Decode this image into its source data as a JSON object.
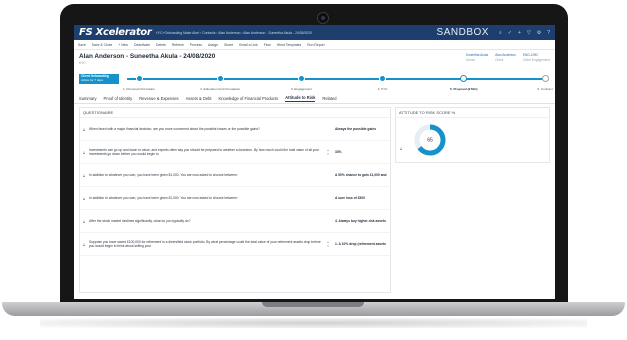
{
  "app": {
    "logo": "FS Xcelerator",
    "breadcrumb": "KYC+Onboarding   Make Alert  ›  Contacts  ›  Alan Anderson  ›  Alan Anderson - Suneetha Akula - 24/08/2020",
    "environment": "SANDBOX"
  },
  "toolbar": {
    "items": [
      "Save",
      "Save & Close",
      "+ New",
      "Deactivate",
      "Delete",
      "Refresh",
      "Process",
      "Assign",
      "Share",
      "Email a Link",
      "Flow",
      "Word Templates",
      "Run Report"
    ]
  },
  "record": {
    "title": "Alan Anderson - Suneetha Akula - 24/08/2020",
    "type": "KYC",
    "owners": [
      {
        "name": "Suneetha Akula",
        "role": "Owner"
      },
      {
        "name": "Alan Anderson",
        "role": "Client"
      },
      {
        "name": "ENG-1092",
        "role": "Client Engagement"
      }
    ]
  },
  "process": {
    "stage_name": "Client Onboarding",
    "stage_duration": "Active for 7 days",
    "steps": [
      {
        "label": "1. Personal Information",
        "status": "done"
      },
      {
        "label": "2. Education And Occupation",
        "status": "done"
      },
      {
        "label": "3. Engagement",
        "status": "done"
      },
      {
        "label": "4. KYC",
        "status": "done"
      },
      {
        "label": "5. Proposal  (9 Min)",
        "status": "current"
      },
      {
        "label": "6. Contract",
        "status": "todo"
      }
    ]
  },
  "tabs": [
    "Summary",
    "Proof of Identity",
    "Revenue & Expenses",
    "Assets & Debt",
    "Knowledge of Financial Products",
    "Attitude to Risk",
    "Related"
  ],
  "active_tab": "Attitude to Risk",
  "questionnaire": {
    "title": "QUESTIONAIRE",
    "questions": [
      {
        "q": "When faced with a major financial decision, are you more concerned about the possible losses or the possible gains?",
        "a": "Always the possible gains",
        "stepper": false
      },
      {
        "q": "Investments can go up and down in value, and experts often say you should be prepared to weather a downturn. By how much could the total value of all your investments go down before you would begin to",
        "a": "33%",
        "stepper": true
      },
      {
        "q": "In addition to whatever you own, you have been given $1,000. You are now asked to choose between:",
        "a": "A 50% chance to gain £1,000 and a 50% chance to g",
        "stepper": false
      },
      {
        "q": "In addition to whatever you own, you have been given £2,000. You are now asked to choose between:",
        "a": "A sure loss of £500",
        "stepper": false
      },
      {
        "q": "After the stock market declines significantly, what do you typically do?",
        "a": "4. Always buy higher-risk assets (e.g., stocks)",
        "stepper": false
      },
      {
        "q": "Suppose you have saved £100,000 for retirement in a diversified stock portfolio. By what percentage could the total value of your retirement assets drop before you would begin to think about selling your",
        "a": "1. A 10% drop (retirement assets drop £50,000 to a v",
        "stepper": true
      }
    ]
  },
  "risk": {
    "title": "ATTITUDE TO RISK SCORE %",
    "score": 65,
    "score_label": "65",
    "color": "#1592c9"
  }
}
